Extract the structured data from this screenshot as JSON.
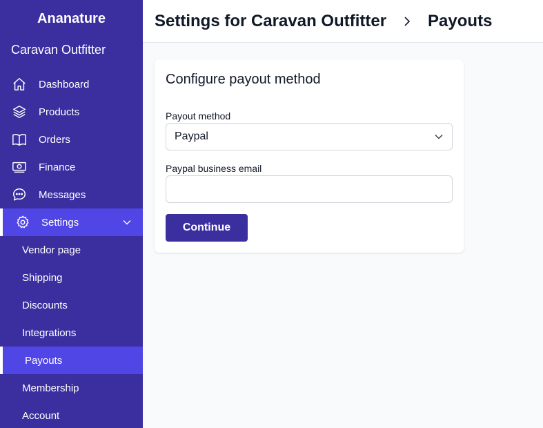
{
  "sidebar": {
    "brand": "Ananature",
    "store_name": "Caravan Outfitter",
    "items": [
      {
        "label": "Dashboard",
        "icon": "home-icon"
      },
      {
        "label": "Products",
        "icon": "layers-icon"
      },
      {
        "label": "Orders",
        "icon": "book-icon"
      },
      {
        "label": "Finance",
        "icon": "banknote-icon"
      },
      {
        "label": "Messages",
        "icon": "chat-icon"
      },
      {
        "label": "Settings",
        "icon": "gear-icon",
        "expanded": true
      }
    ],
    "sub_items": [
      {
        "label": "Vendor page"
      },
      {
        "label": "Shipping"
      },
      {
        "label": "Discounts"
      },
      {
        "label": "Integrations"
      },
      {
        "label": "Payouts",
        "active": true
      },
      {
        "label": "Membership"
      },
      {
        "label": "Account"
      }
    ],
    "colors": {
      "background": "#3b2fa0",
      "active": "#4f46e5"
    }
  },
  "header": {
    "title": "Settings for Caravan Outfitter",
    "current": "Payouts"
  },
  "card": {
    "title": "Configure payout method",
    "payout_method_label": "Payout method",
    "payout_method_value": "Paypal",
    "email_label": "Paypal business email",
    "email_value": "",
    "email_placeholder": "",
    "continue_label": "Continue"
  }
}
